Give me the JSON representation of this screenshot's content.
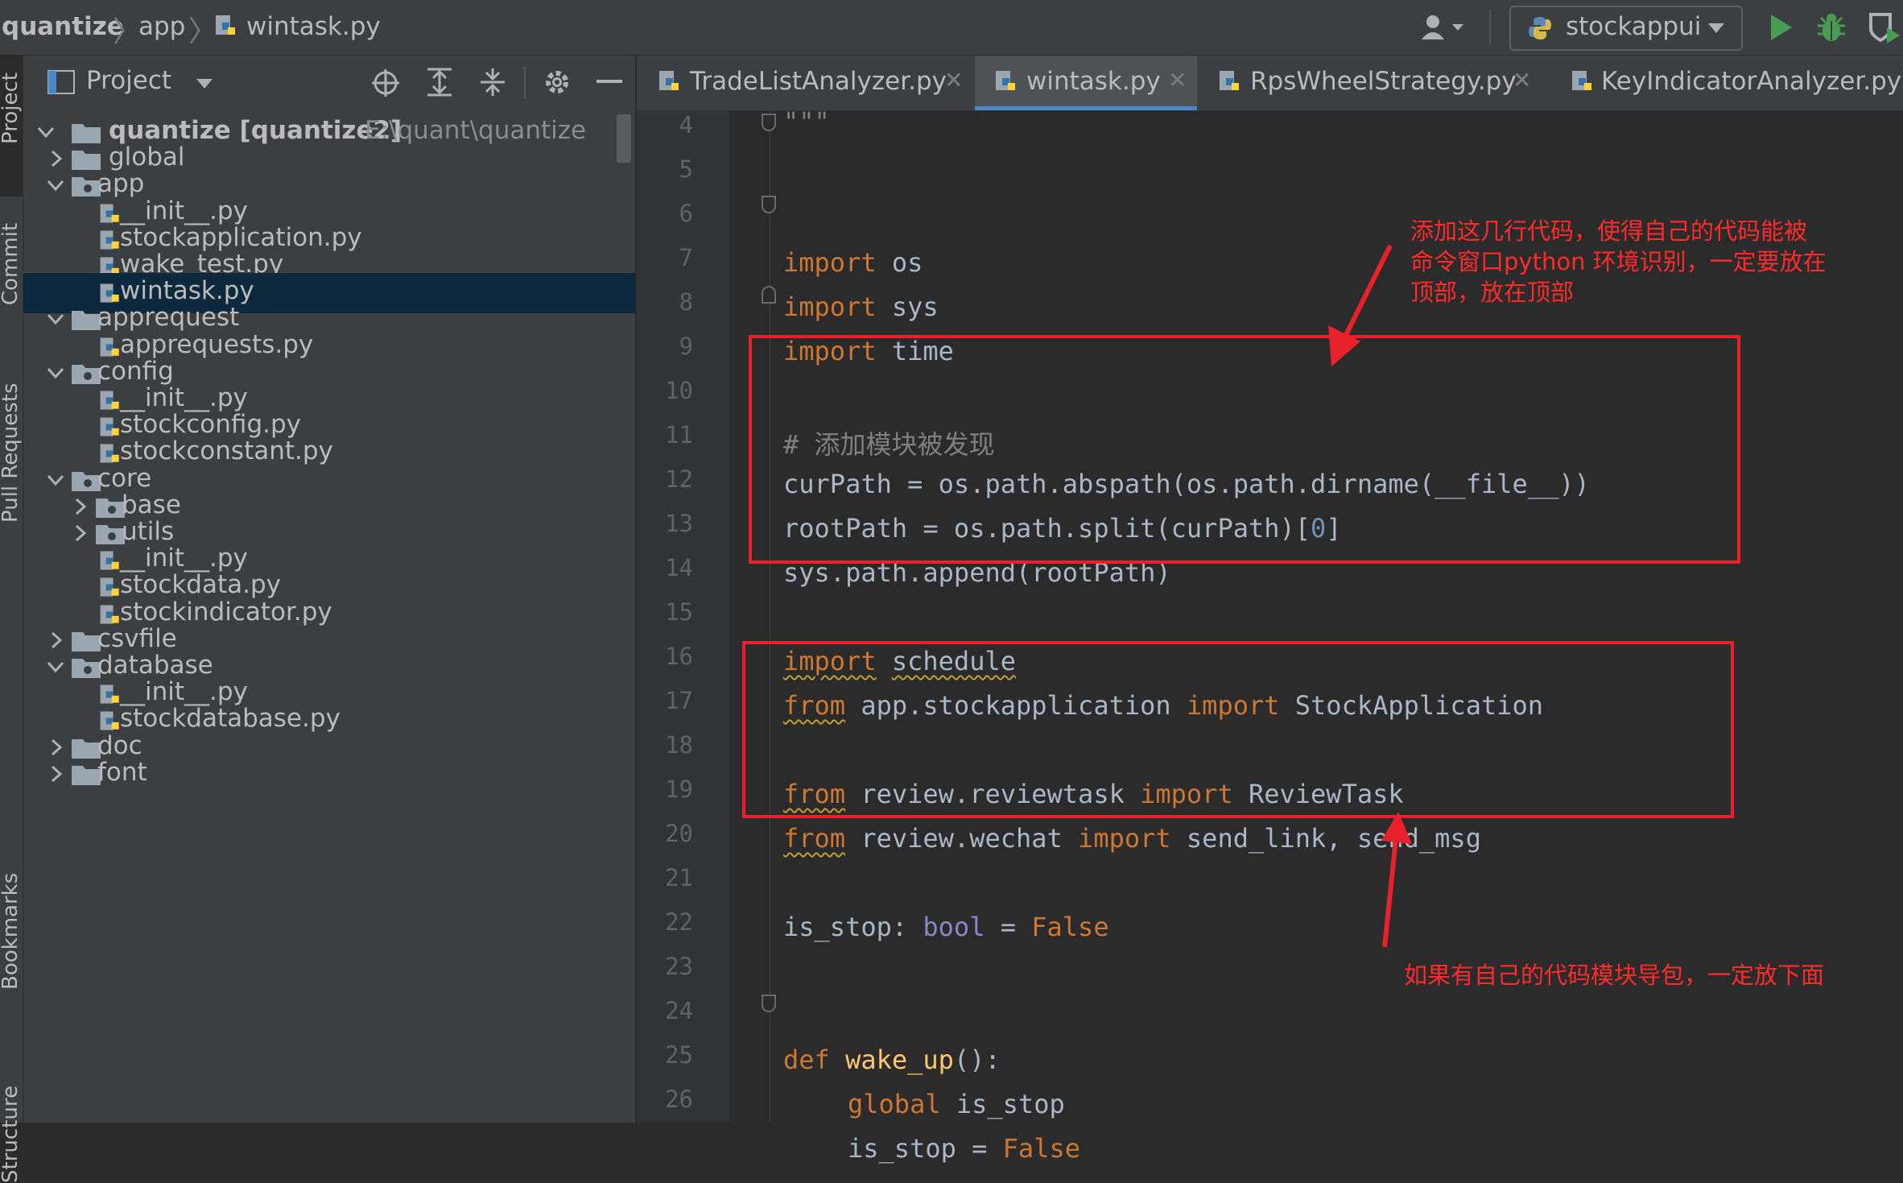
{
  "breadcrumb": {
    "project": "quantize",
    "folder": "app",
    "file": "wintask.py"
  },
  "toolbar": {
    "run_config": "stockappui",
    "user_icon": "user-icon",
    "run_icon": "run-icon",
    "debug_icon": "debug-icon",
    "coverage_icon": "coverage-icon"
  },
  "left_strip": {
    "tabs": [
      "Project",
      "Commit",
      "Pull Requests",
      "Bookmarks",
      "Structure"
    ]
  },
  "project_panel": {
    "title": "Project",
    "root": {
      "name": "quantize [quantize2]",
      "path": "E:\\quant\\quantize"
    },
    "items": [
      {
        "label": "global",
        "type": "folder",
        "expanded": false
      },
      {
        "label": "app",
        "type": "package",
        "expanded": true
      },
      {
        "label": "__init__.py",
        "type": "file"
      },
      {
        "label": "stockapplication.py",
        "type": "file"
      },
      {
        "label": "wake_test.py",
        "type": "file"
      },
      {
        "label": "wintask.py",
        "type": "file",
        "selected": true
      },
      {
        "label": "apprequest",
        "type": "folder",
        "expanded": true
      },
      {
        "label": "apprequests.py",
        "type": "file"
      },
      {
        "label": "config",
        "type": "package",
        "expanded": true
      },
      {
        "label": "__init__.py",
        "type": "file"
      },
      {
        "label": "stockconfig.py",
        "type": "file"
      },
      {
        "label": "stockconstant.py",
        "type": "file"
      },
      {
        "label": "core",
        "type": "package",
        "expanded": true
      },
      {
        "label": "base",
        "type": "package",
        "expanded": false
      },
      {
        "label": "utils",
        "type": "package",
        "expanded": false
      },
      {
        "label": "__init__.py",
        "type": "file"
      },
      {
        "label": "stockdata.py",
        "type": "file"
      },
      {
        "label": "stockindicator.py",
        "type": "file"
      },
      {
        "label": "csvfile",
        "type": "folder",
        "expanded": false
      },
      {
        "label": "database",
        "type": "package",
        "expanded": true
      },
      {
        "label": "__init__.py",
        "type": "file"
      },
      {
        "label": "stockdatabase.py",
        "type": "file"
      },
      {
        "label": "doc",
        "type": "folder",
        "expanded": false
      },
      {
        "label": "font",
        "type": "folder",
        "expanded": false
      }
    ]
  },
  "tabs": [
    {
      "label": "TradeListAnalyzer.py",
      "active": false
    },
    {
      "label": "wintask.py",
      "active": true
    },
    {
      "label": "RpsWheelStrategy.py",
      "active": false
    },
    {
      "label": "KeyIndicatorAnalyzer.py",
      "active": false
    }
  ],
  "editor": {
    "line_numbers": [
      "4",
      "5",
      "6",
      "7",
      "8",
      "9",
      "10",
      "11",
      "12",
      "13",
      "14",
      "15",
      "16",
      "17",
      "18",
      "19",
      "20",
      "21",
      "22",
      "23",
      "24",
      "25",
      "26"
    ],
    "code": {
      "l4": "\"\"\"",
      "l6_kw": "import",
      "l6_rest": " os",
      "l7_kw": "import",
      "l7_rest": " sys",
      "l8_kw": "import",
      "l8_rest": " time",
      "l10": "# 添加模块被发现",
      "l11": "curPath = os.path.abspath(os.path.dirname(__file__))",
      "l12_a": "rootPath = os.path.split(curPath)[",
      "l12_num": "0",
      "l12_b": "]",
      "l13": "sys.path.append(rootPath)",
      "l15_kw": "import",
      "l15_mod": "schedule",
      "l16_kw1": "from",
      "l16_mod": " app.stockapplication ",
      "l16_kw2": "import",
      "l16_name": " StockApplication",
      "l18_kw1": "from",
      "l18_mod": " review.reviewtask ",
      "l18_kw2": "import",
      "l18_name": " ReviewTask",
      "l19_kw1": "from",
      "l19_mod": " review.wechat ",
      "l19_kw2": "import",
      "l19_name": " send_link, send_msg",
      "l21_a": "is_stop: ",
      "l21_type": "bool",
      "l21_b": " = ",
      "l21_val": "False",
      "l24_kw": "def",
      "l24_fn": " wake_up",
      "l24_rest": "():",
      "l25_kw": "global",
      "l25_rest": " is_stop",
      "l26_a": "is_stop = ",
      "l26_val": "False"
    }
  },
  "annotations": {
    "top_note": [
      "添加这几行代码，使得自己的代码能被",
      "命令窗口python 环境识别，一定要放在",
      "顶部，放在顶部"
    ],
    "bottom_note": "如果有自己的代码模块导包，一定放下面",
    "color": "#e8222b"
  }
}
